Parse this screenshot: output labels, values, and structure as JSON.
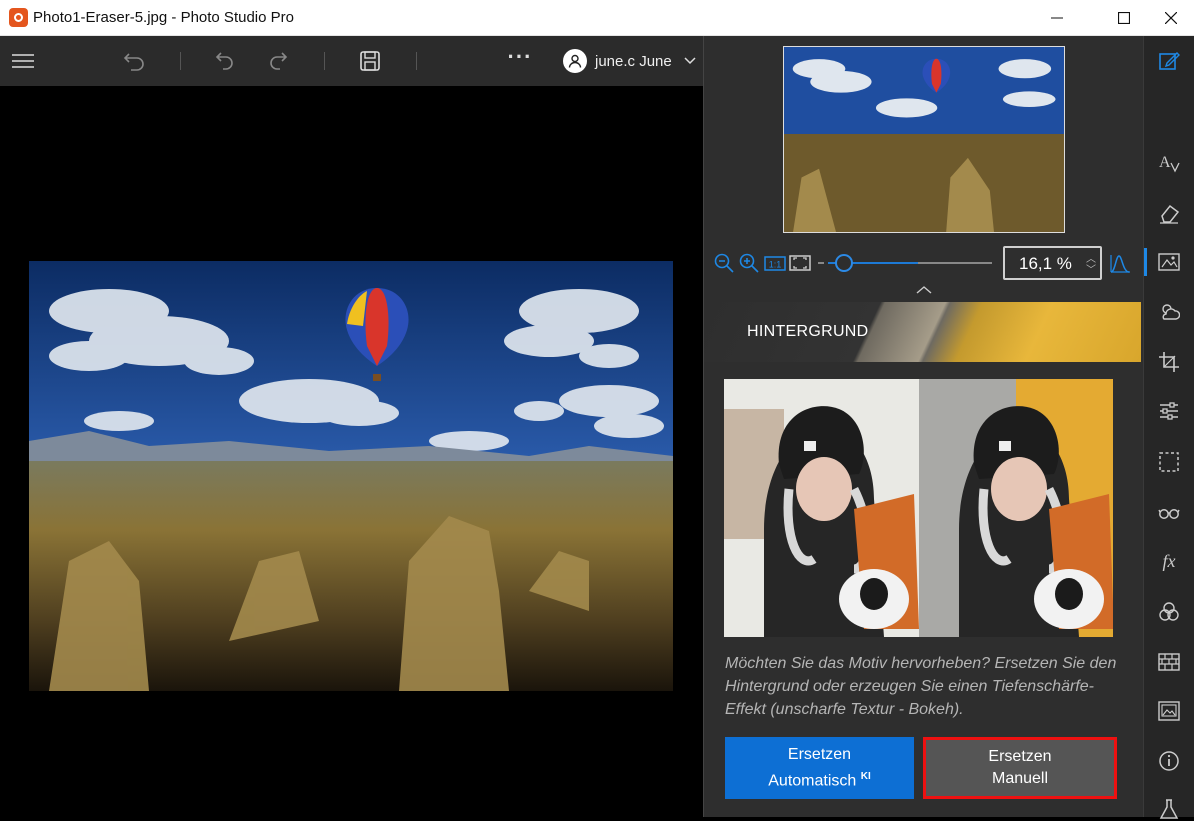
{
  "window": {
    "title": "Photo1-Eraser-5.jpg - Photo Studio Pro",
    "icon": "app-logo-icon",
    "controls": [
      "minimize-icon",
      "maximize-icon",
      "close-icon"
    ]
  },
  "toolbar": {
    "icons": [
      "menu-icon",
      "undo-all-icon",
      "undo-icon",
      "redo-icon",
      "save-icon",
      "more-icon"
    ],
    "more_label": "···",
    "user": {
      "name": "june.c June",
      "icon": "user-icon",
      "dropdown_icon": "chevron-down-icon"
    }
  },
  "navigator": {
    "zoom_value": "16,1 %",
    "slider_fraction": 0.55,
    "icons": [
      "zoom-out-icon",
      "zoom-in-icon",
      "actual-size-icon",
      "fit-screen-icon",
      "histogram-icon"
    ]
  },
  "panel": {
    "section_title": "HINTERGRUND",
    "description": "Möchten Sie das Motiv hervorheben? Ersetzen Sie den Hintergrund oder erzeugen Sie einen Tiefenschärfe-Effekt (unscharfe Textur - Bokeh).",
    "button_auto": {
      "line1": "Ersetzen",
      "line2": "Automatisch",
      "badge": "KI"
    },
    "button_manual": {
      "line1": "Ersetzen",
      "line2": "Manuell"
    }
  },
  "sidebar": {
    "icons": [
      "edit-icon",
      "text-icon",
      "eraser-icon",
      "background-icon",
      "weather-icon",
      "crop-icon",
      "adjust-icon",
      "selection-icon",
      "glasses-icon",
      "fx-icon",
      "color-mix-icon",
      "texture-icon",
      "image-icon",
      "info-icon",
      "lab-icon"
    ],
    "fx_label": "fx",
    "active_index": 3
  },
  "colors": {
    "accent": "#1e88e5",
    "button_blue": "#0d6fd4",
    "highlight_red": "#e11111"
  }
}
